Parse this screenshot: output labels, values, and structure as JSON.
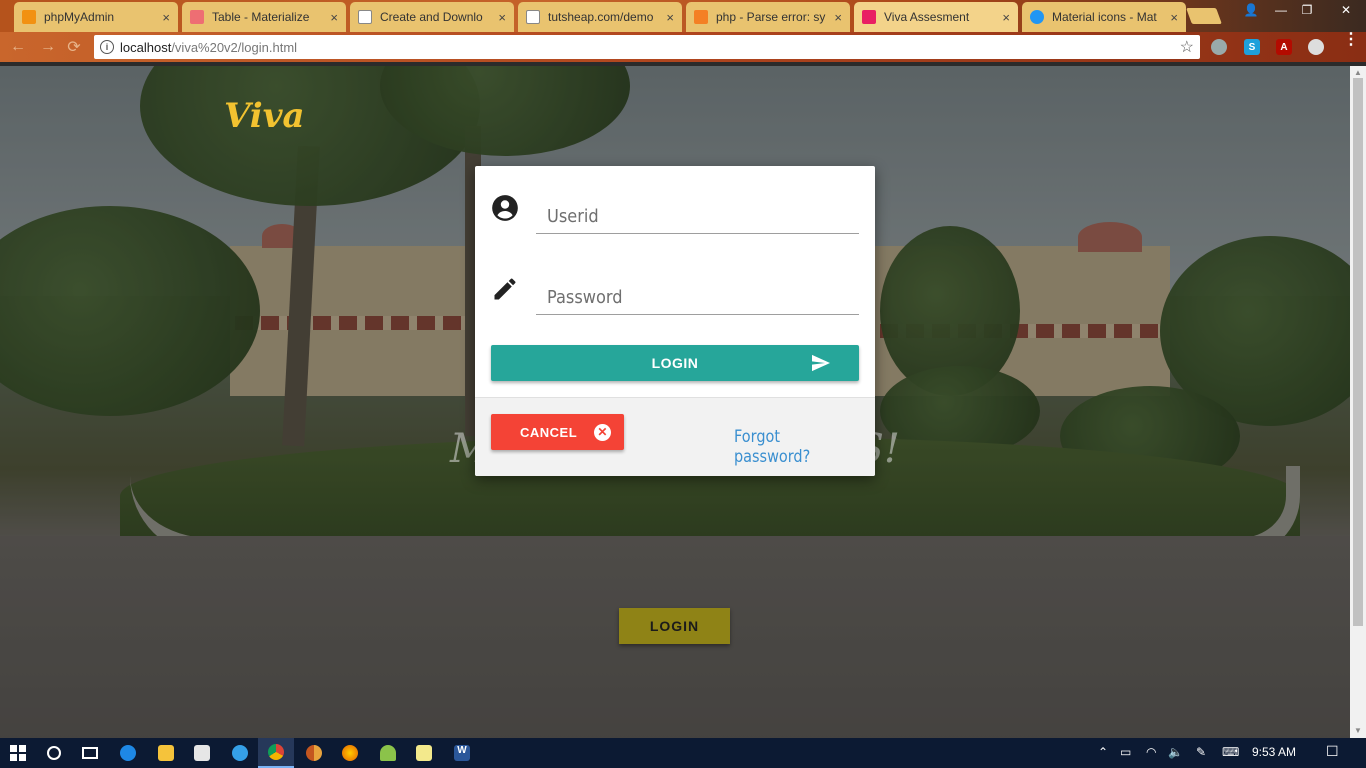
{
  "browser": {
    "tabs": [
      {
        "title": "phpMyAdmin",
        "favicon_color": "#f29111"
      },
      {
        "title": "Table - Materialize",
        "favicon_color": "#ee6e73"
      },
      {
        "title": "Create and Downlo",
        "favicon_color": "#888888"
      },
      {
        "title": "tutsheap.com/demo",
        "favicon_color": "#888888"
      },
      {
        "title": "php - Parse error: sy",
        "favicon_color": "#f48024"
      },
      {
        "title": "Viva Assesment",
        "favicon_color": "#e91e63"
      },
      {
        "title": "Material icons - Mat",
        "favicon_color": "#2196f3"
      }
    ],
    "tab_close_glyph": "×",
    "window_controls": {
      "user": "👤",
      "minimize": "—",
      "restore": "❐",
      "close": "✕"
    },
    "nav": {
      "back": "←",
      "forward": "→",
      "reload": "⟳"
    },
    "address": {
      "host": "localhost",
      "path": "/viva%20v2/login.html"
    },
    "bookmark_star": "☆",
    "menu": "⋮"
  },
  "page": {
    "brand": "Viva",
    "hero_left": "M",
    "hero_right": "S!",
    "background_login_label": "LOGIN"
  },
  "login_card": {
    "userid_placeholder": "Userid",
    "password_placeholder": "Password",
    "login_label": "LOGIN",
    "cancel_label": "CANCEL",
    "forgot_label": "Forgot password?",
    "colors": {
      "login": "#26a69a",
      "cancel": "#f44336",
      "link": "#3a8fd0"
    }
  },
  "taskbar": {
    "icons": [
      "windows-start",
      "cortana",
      "task-view",
      "edge",
      "file-explorer",
      "store",
      "internet-explorer",
      "chrome",
      "chrome-canary",
      "firefox",
      "android-studio",
      "notepad",
      "word"
    ],
    "clock": "9:53 AM"
  }
}
